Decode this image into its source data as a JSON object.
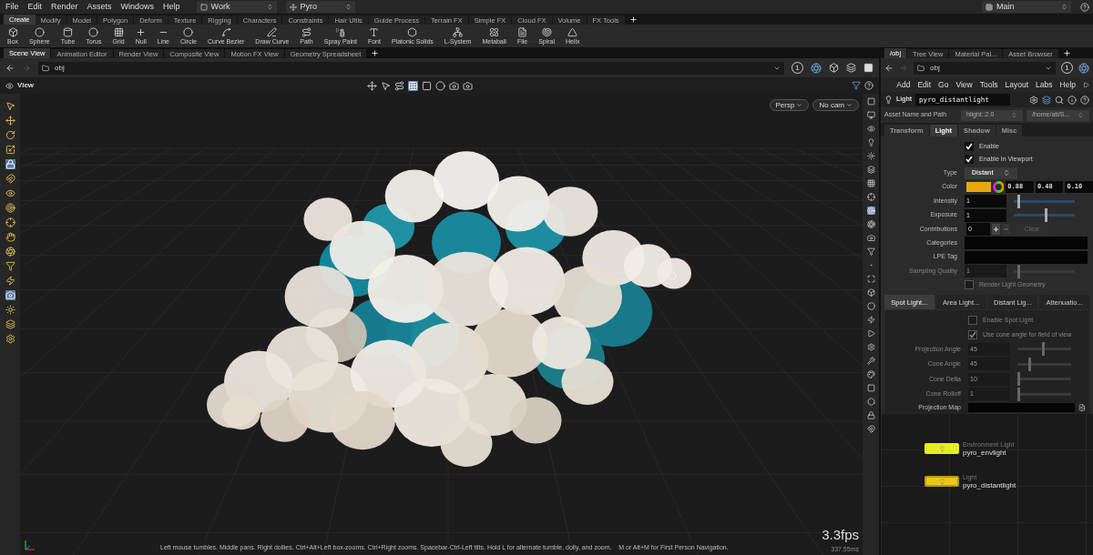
{
  "menu": [
    "File",
    "Edit",
    "Render",
    "Assets",
    "Windows",
    "Help"
  ],
  "desktop": "Work",
  "context": "Pyro",
  "main_desktop": "Main",
  "shelf_tabs": [
    {
      "label": "Create",
      "selected": true
    },
    {
      "label": "Modify",
      "selected": false
    },
    {
      "label": "Model",
      "selected": false
    },
    {
      "label": "Polygon",
      "selected": false
    },
    {
      "label": "Deform",
      "selected": false
    },
    {
      "label": "Texture",
      "selected": false
    },
    {
      "label": "Rigging",
      "selected": false
    },
    {
      "label": "Characters",
      "selected": false
    },
    {
      "label": "Constraints",
      "selected": false
    },
    {
      "label": "Hair Utils",
      "selected": false
    },
    {
      "label": "Guide Process",
      "selected": false
    },
    {
      "label": "Terrain FX",
      "selected": false
    },
    {
      "label": "Simple FX",
      "selected": false
    },
    {
      "label": "Cloud FX",
      "selected": false
    },
    {
      "label": "Volume",
      "selected": false
    },
    {
      "label": "FX Tools",
      "selected": false
    }
  ],
  "shelf_tools": [
    "Box",
    "Sphere",
    "Tube",
    "Torus",
    "Grid",
    "Null",
    "Line",
    "Circle",
    "Curve Bezier",
    "Draw Curve",
    "Path",
    "Spray Paint",
    "Font",
    "Platonic Solids",
    "L-System",
    "Metaball",
    "File",
    "Spiral",
    "Helix"
  ],
  "scene_tabs": [
    {
      "label": "Scene View",
      "selected": true
    },
    {
      "label": "Animation Editor",
      "selected": false
    },
    {
      "label": "Render View",
      "selected": false
    },
    {
      "label": "Composite View",
      "selected": false
    },
    {
      "label": "Motion FX View",
      "selected": false
    },
    {
      "label": "Geometry Spreadsheet",
      "selected": false
    }
  ],
  "scene_path": "obj",
  "scene_counter": "1",
  "view_label": "View",
  "camera_menus": [
    "Persp",
    "No cam"
  ],
  "fps": "3.3fps",
  "frame_time": "337.55ms",
  "status_hint": "Left mouse tumbles. Middle pans. Right dollies. Ctrl+Alt+Left box-zooms. Ctrl+Right zooms. Spacebar-Ctrl-Left tilts. Hold L for alternate tumble, dolly, and zoom.    M or Alt+M for First Person Navigation.",
  "right_tabs": [
    {
      "label": "/obj",
      "selected": true
    },
    {
      "label": "Tree View",
      "selected": false
    },
    {
      "label": "Material Pal...",
      "selected": false
    },
    {
      "label": "Asset Browser",
      "selected": false
    }
  ],
  "right_path": "obj",
  "right_counter": "1",
  "right_menu": [
    "Add",
    "Edit",
    "Go",
    "View",
    "Tools",
    "Layout",
    "Labs",
    "Help"
  ],
  "node": {
    "type": "Light",
    "name": "pyro_distantlight"
  },
  "asset": {
    "label": "Asset Name and Path",
    "name": "hlight::2.0",
    "path": "/home/ati/S..."
  },
  "param_tabs": [
    {
      "label": "Transform",
      "selected": false
    },
    {
      "label": "Light",
      "selected": true
    },
    {
      "label": "Shadow",
      "selected": false
    },
    {
      "label": "Misc",
      "selected": false
    }
  ],
  "params": [
    {
      "kind": "checkbox",
      "label": "Enable",
      "checked": true,
      "disabled": false
    },
    {
      "kind": "checkbox",
      "label": "Enable In Viewport",
      "checked": true,
      "disabled": false
    },
    {
      "kind": "menu",
      "label": "Type",
      "value": "Distant"
    },
    {
      "kind": "color",
      "label": "Color",
      "color": "#e8a80c",
      "values": [
        "0.88",
        "0.48",
        "0.10"
      ]
    },
    {
      "kind": "slider",
      "label": "Intensity",
      "value": "1",
      "level": 0.1,
      "disabled": false
    },
    {
      "kind": "slider",
      "label": "Exposure",
      "value": "1",
      "level": 0.55,
      "disabled": false
    },
    {
      "kind": "contrib",
      "label": "Contributions",
      "value": "0",
      "button": "Clear"
    },
    {
      "kind": "text",
      "label": "Categories"
    },
    {
      "kind": "text",
      "label": "LPE Tag"
    },
    {
      "kind": "slider",
      "label": "Sampling Quality",
      "value": "1",
      "level": 0.1,
      "disabled": true
    },
    {
      "kind": "checkbox",
      "label": "Render Light Geometry",
      "checked": false,
      "disabled": true
    }
  ],
  "sub_tabs": [
    {
      "label": "Spot Light...",
      "selected": true
    },
    {
      "label": "Area Light...",
      "selected": false
    },
    {
      "label": "Distant Lig...",
      "selected": false
    },
    {
      "label": "Attenuatio...",
      "selected": false
    }
  ],
  "sub_params": [
    {
      "kind": "checkbox",
      "label": "Enable Spot Light",
      "checked": false,
      "disabled": true
    },
    {
      "kind": "checkbox",
      "label": "Use cone angle for field of view",
      "checked": true,
      "disabled": true
    },
    {
      "kind": "slider",
      "label": "Projection Angle",
      "value": "45",
      "level": 0.5,
      "disabled": true
    },
    {
      "kind": "slider",
      "label": "Cone Angle",
      "value": "45",
      "level": 0.25,
      "disabled": true
    },
    {
      "kind": "slider",
      "label": "Cone Delta",
      "value": "10",
      "level": 0.05,
      "disabled": true
    },
    {
      "kind": "slider",
      "label": "Cone Rolloff",
      "value": "1",
      "level": 0.05,
      "disabled": true
    },
    {
      "kind": "file",
      "label": "Projection Map"
    }
  ],
  "network_nodes": [
    {
      "type": "Environment Light",
      "name": "pyro_envlight",
      "color": "#e4f01c",
      "selected": false
    },
    {
      "type": "Light",
      "name": "pyro_distantlight",
      "color": "#e8c81a",
      "selected": true
    }
  ]
}
